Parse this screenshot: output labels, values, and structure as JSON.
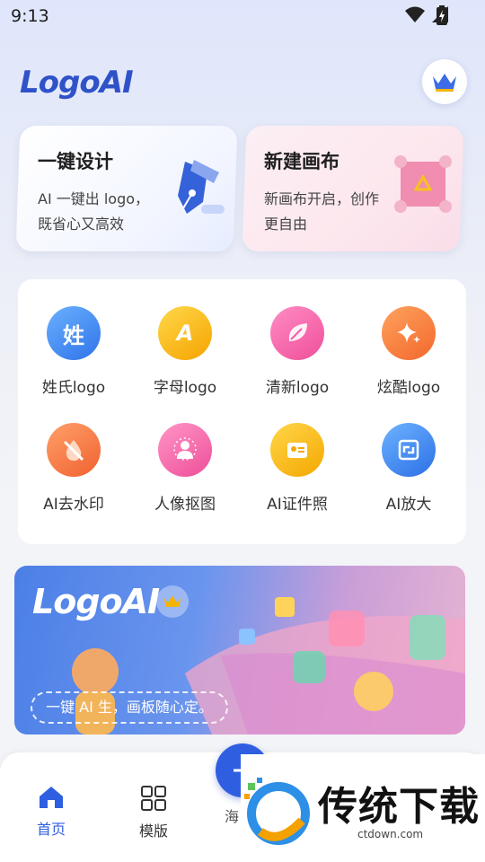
{
  "status_bar": {
    "time": "9:13"
  },
  "header": {
    "logo": "LogoAI",
    "vip_icon": "crown-icon"
  },
  "cards": [
    {
      "title": "一键设计",
      "desc": "AI 一键出 logo，既省心又高效",
      "icon": "pen-nib-icon"
    },
    {
      "title": "新建画布",
      "desc": "新画布开启，创作更自由",
      "icon": "canvas-icon"
    }
  ],
  "tools": [
    {
      "label": "姓氏logo",
      "glyph": "姓",
      "color": "#3a86f0"
    },
    {
      "label": "字母logo",
      "glyph": "A",
      "color": "#f7b500"
    },
    {
      "label": "清新logo",
      "glyph": "",
      "color": "#f25ea5"
    },
    {
      "label": "炫酷logo",
      "glyph": "",
      "color": "#f5803a"
    },
    {
      "label": "AI去水印",
      "glyph": "",
      "color": "#f27a4a"
    },
    {
      "label": "人像抠图",
      "glyph": "",
      "color": "#f35fa3"
    },
    {
      "label": "AI证件照",
      "glyph": "",
      "color": "#f7b500"
    },
    {
      "label": "AI放大",
      "glyph": "",
      "color": "#3a86f0"
    }
  ],
  "banner": {
    "title": "LogoAI",
    "slogan": "一键 AI 生，画板随心定。"
  },
  "bottom_nav": {
    "items": [
      {
        "label": "首页",
        "active": true,
        "color": "#2f5fe0"
      },
      {
        "label": "模版",
        "active": false,
        "color": "#333333"
      }
    ],
    "center_label": "海"
  },
  "watermark": {
    "text": "传统下载",
    "url": "ctdown.com"
  }
}
